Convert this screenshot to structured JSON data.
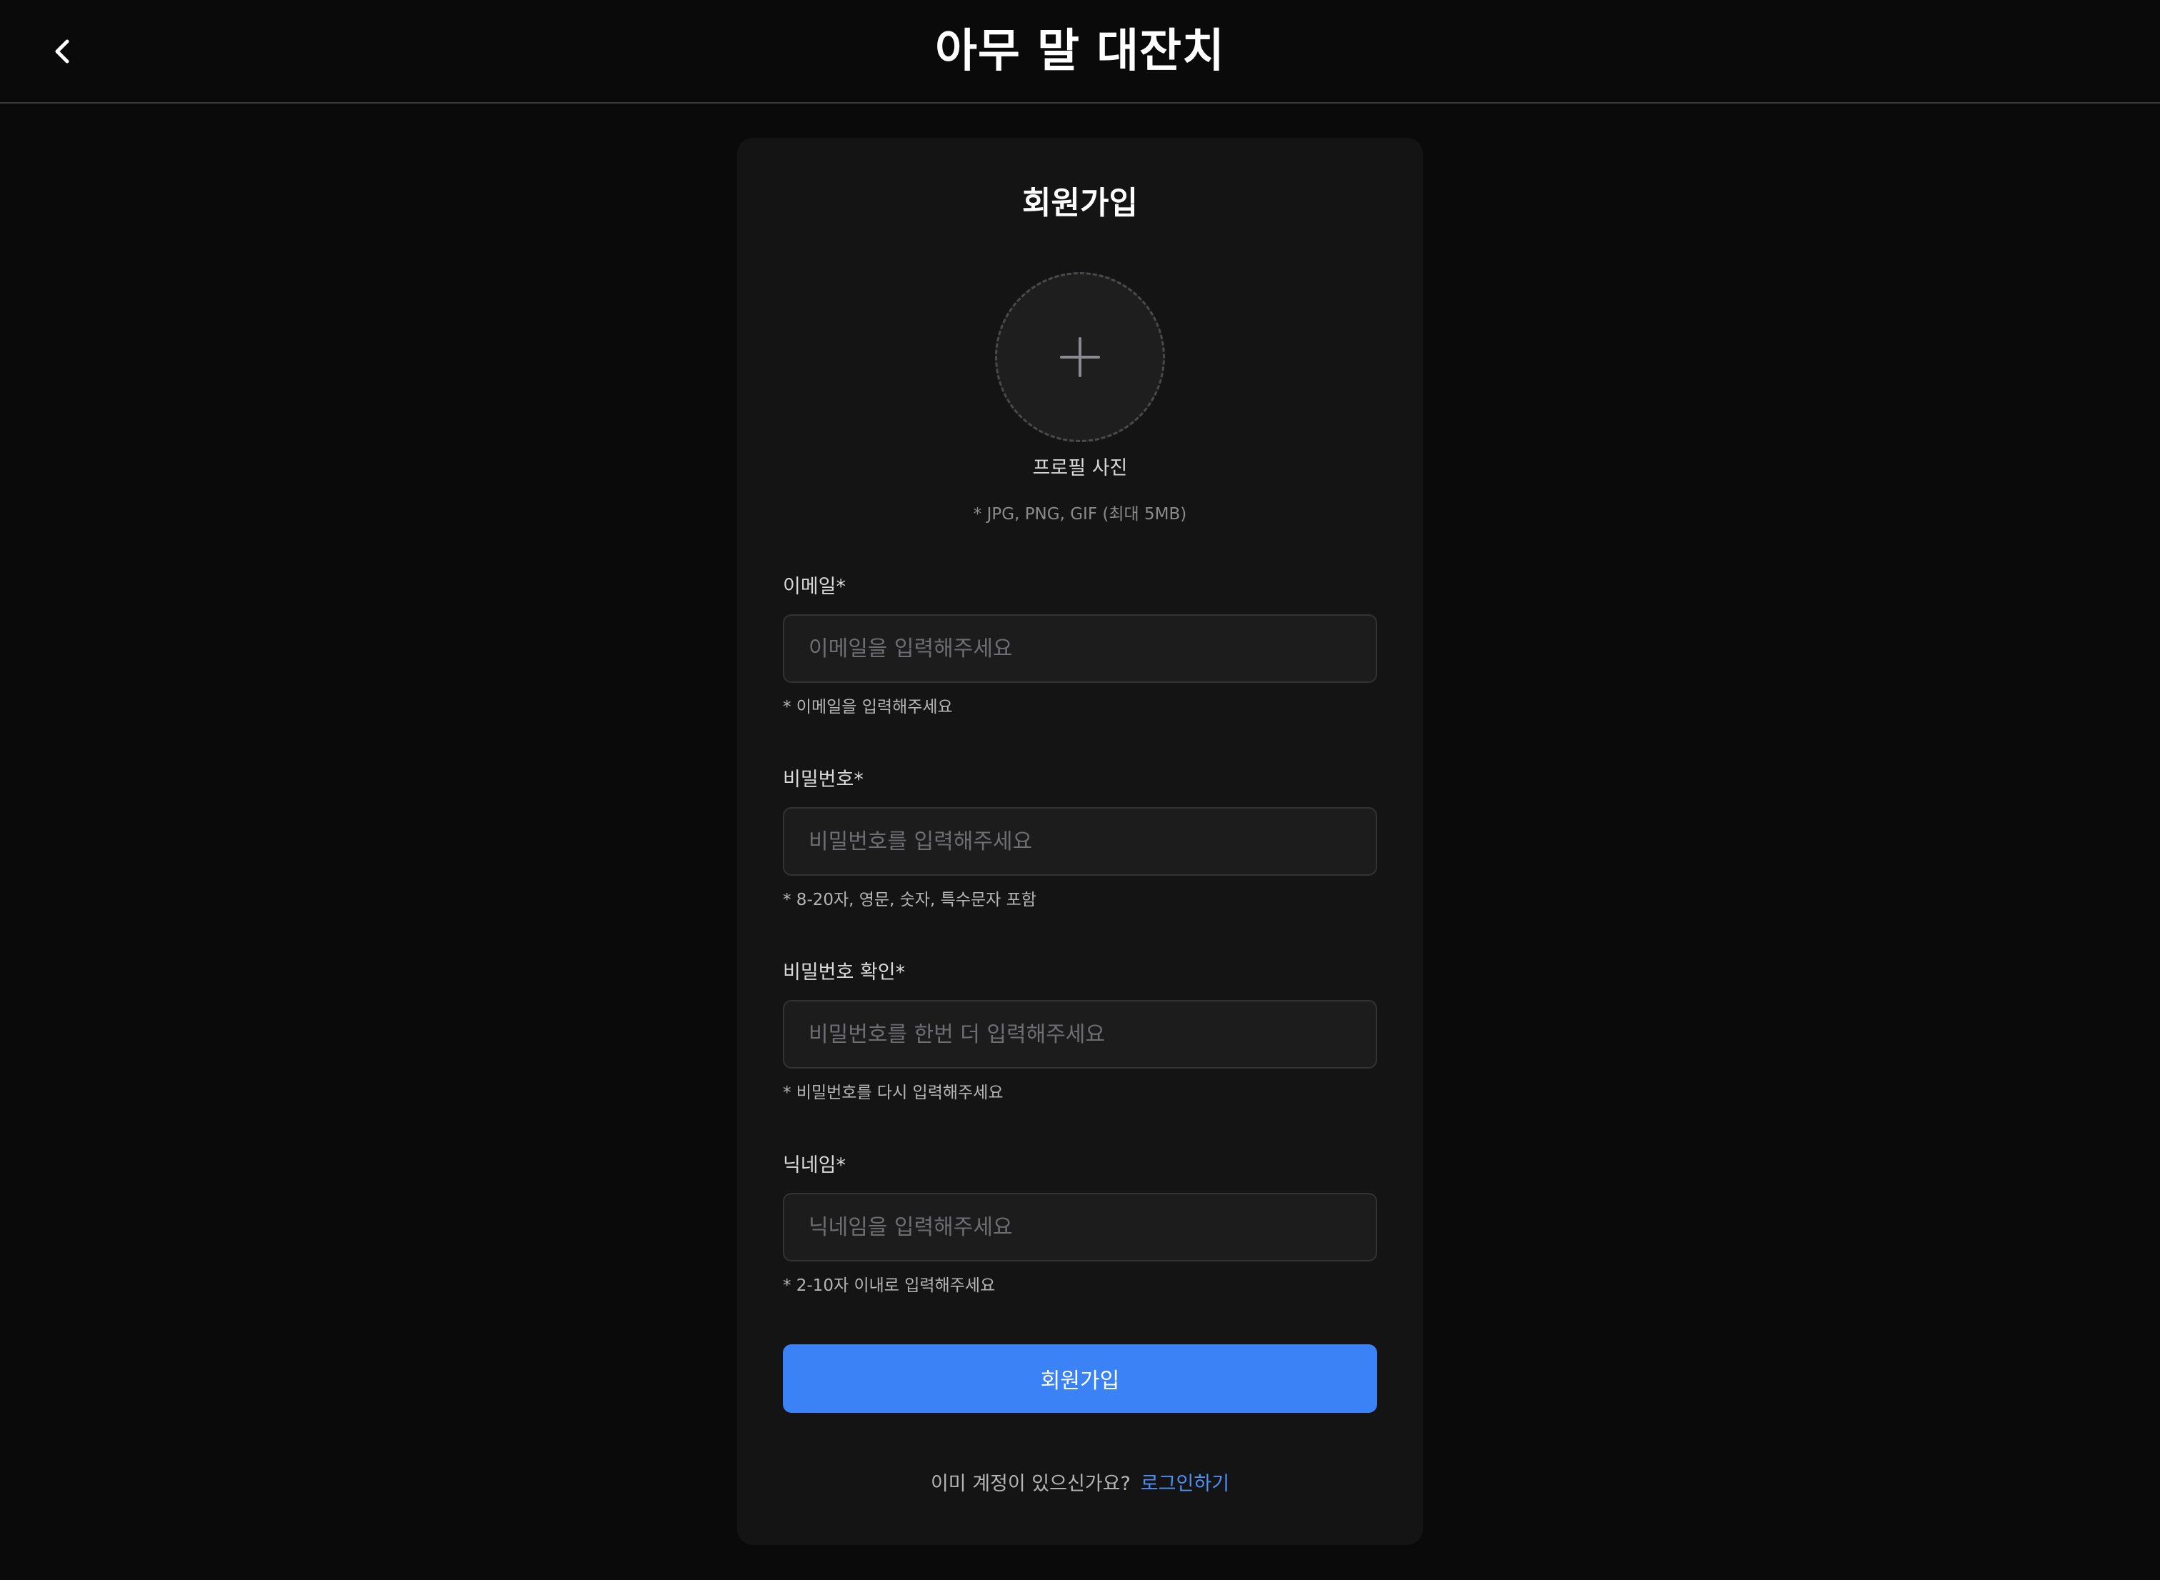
{
  "header": {
    "title": "아무 말 대잔치",
    "back_icon": "chevron-left-icon"
  },
  "signup": {
    "title": "회원가입",
    "avatar": {
      "icon": "plus-icon",
      "label": "프로필 사진",
      "hint": "* JPG, PNG, GIF (최대 5MB)"
    },
    "fields": {
      "email": {
        "label": "이메일*",
        "placeholder": "이메일을 입력해주세요",
        "value": "",
        "help": "* 이메일을 입력해주세요"
      },
      "password": {
        "label": "비밀번호*",
        "placeholder": "비밀번호를 입력해주세요",
        "value": "",
        "help": "* 8-20자, 영문, 숫자, 특수문자 포함"
      },
      "password_confirm": {
        "label": "비밀번호 확인*",
        "placeholder": "비밀번호를 한번 더 입력해주세요",
        "value": "",
        "help": "* 비밀번호를 다시 입력해주세요"
      },
      "nickname": {
        "label": "닉네임*",
        "placeholder": "닉네임을 입력해주세요",
        "value": "",
        "help": "* 2-10자 이내로 입력해주세요"
      }
    },
    "submit_label": "회원가입",
    "login_prompt": {
      "question": "이미 계정이 있으신가요?",
      "link": "로그인하기"
    }
  },
  "colors": {
    "background": "#0a0a0a",
    "card": "#141414",
    "accent": "#3b82f6",
    "link": "#4e8ff6"
  }
}
